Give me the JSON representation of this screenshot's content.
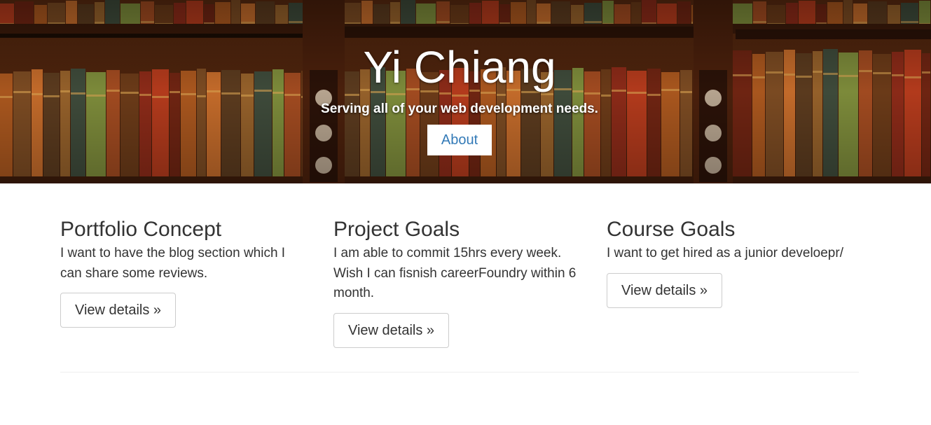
{
  "hero": {
    "title": "Yi Chiang",
    "tagline": "Serving all of your web development needs.",
    "about_label": "About"
  },
  "columns": [
    {
      "heading": "Portfolio Concept",
      "text": "I want to have the blog section which I can share some reviews.",
      "button_label": "View details »"
    },
    {
      "heading": "Project Goals",
      "text": "I am able to commit 15hrs every week. Wish I can fisnish careerFoundry within 6 month.",
      "button_label": "View details »"
    },
    {
      "heading": "Course Goals",
      "text": "I want to get hired as a junior develoepr/",
      "button_label": "View details »"
    }
  ],
  "colors": {
    "link_blue": "#337ab7",
    "text": "#333333",
    "button_border": "#cccccc",
    "divider": "#eeeeee"
  }
}
